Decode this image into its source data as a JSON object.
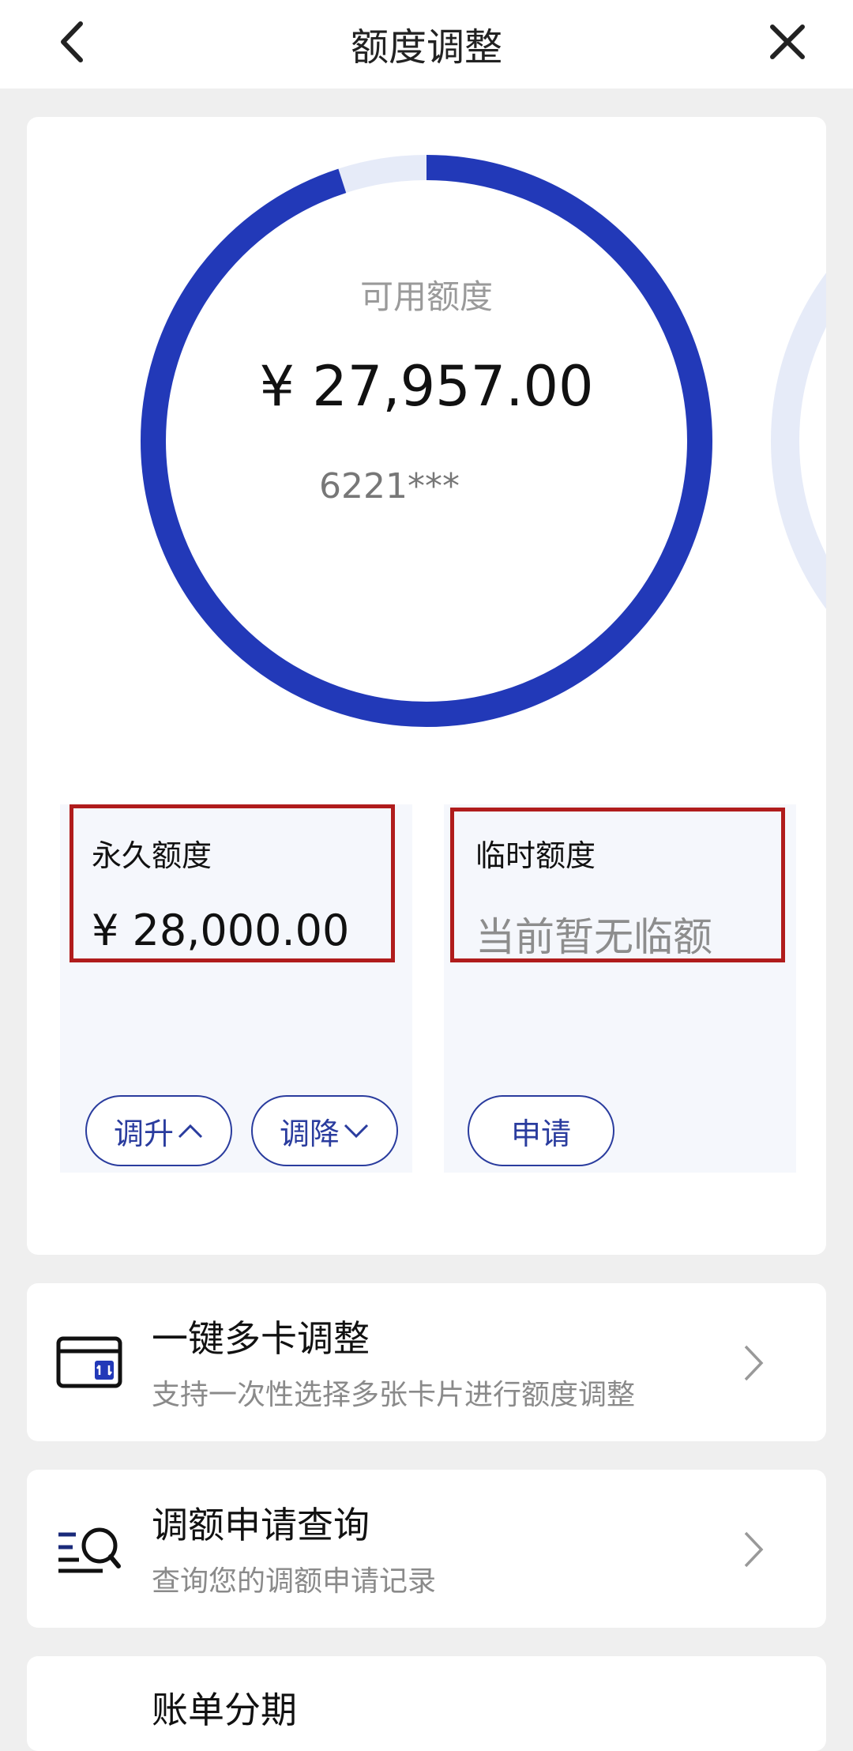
{
  "header": {
    "title": "额度调整"
  },
  "available": {
    "label": "可用额度",
    "amount": "¥ 27,957.00",
    "card_number": "6221***",
    "used_fraction": 0.0015,
    "colors": {
      "ring": "#2239b8",
      "track": "#e6ebf8"
    }
  },
  "permanent": {
    "title": "永久额度",
    "amount": "¥ 28,000.00",
    "raise_label": "调升",
    "lower_label": "调降"
  },
  "temporary": {
    "title": "临时额度",
    "amount": "当前暂无临额",
    "apply_label": "申请"
  },
  "list": [
    {
      "title": "一键多卡调整",
      "subtitle": "支持一次性选择多张卡片进行额度调整",
      "icon": "card-adjust-icon"
    },
    {
      "title": "调额申请查询",
      "subtitle": "查询您的调额申请记录",
      "icon": "search-list-icon"
    },
    {
      "title": "账单分期",
      "icon": "installment-icon"
    }
  ]
}
